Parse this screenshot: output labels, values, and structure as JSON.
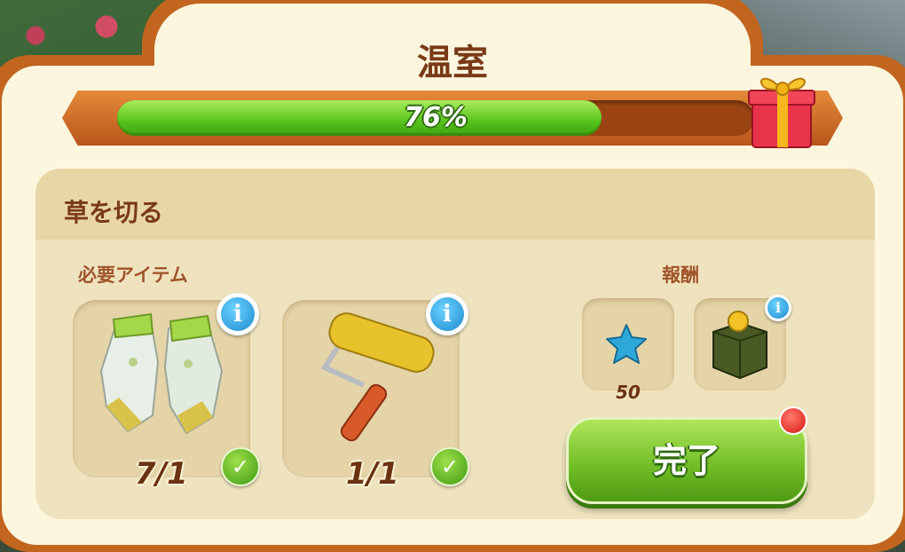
{
  "panel": {
    "title": "温室",
    "progress": {
      "percent": 76,
      "label": "76%"
    }
  },
  "task": {
    "title": "草を切る",
    "required_items_label": "必要アイテム",
    "rewards_label": "報酬",
    "items": [
      {
        "name": "gloves",
        "count": "7/1",
        "icon": "garden-gloves-icon"
      },
      {
        "name": "paint-roller",
        "count": "1/1",
        "icon": "paint-roller-icon"
      }
    ],
    "rewards": [
      {
        "icon": "blue-star-icon",
        "value": "50"
      },
      {
        "icon": "coin-box-icon",
        "value": ""
      }
    ],
    "complete_label": "完了",
    "info_glyph": "i",
    "check_glyph": "✓"
  },
  "colors": {
    "frame": "#c1651f",
    "panel": "#fcf6de",
    "title": "#7a3a17",
    "progress_fill": "#57c21c",
    "button": "#6fbb25"
  }
}
